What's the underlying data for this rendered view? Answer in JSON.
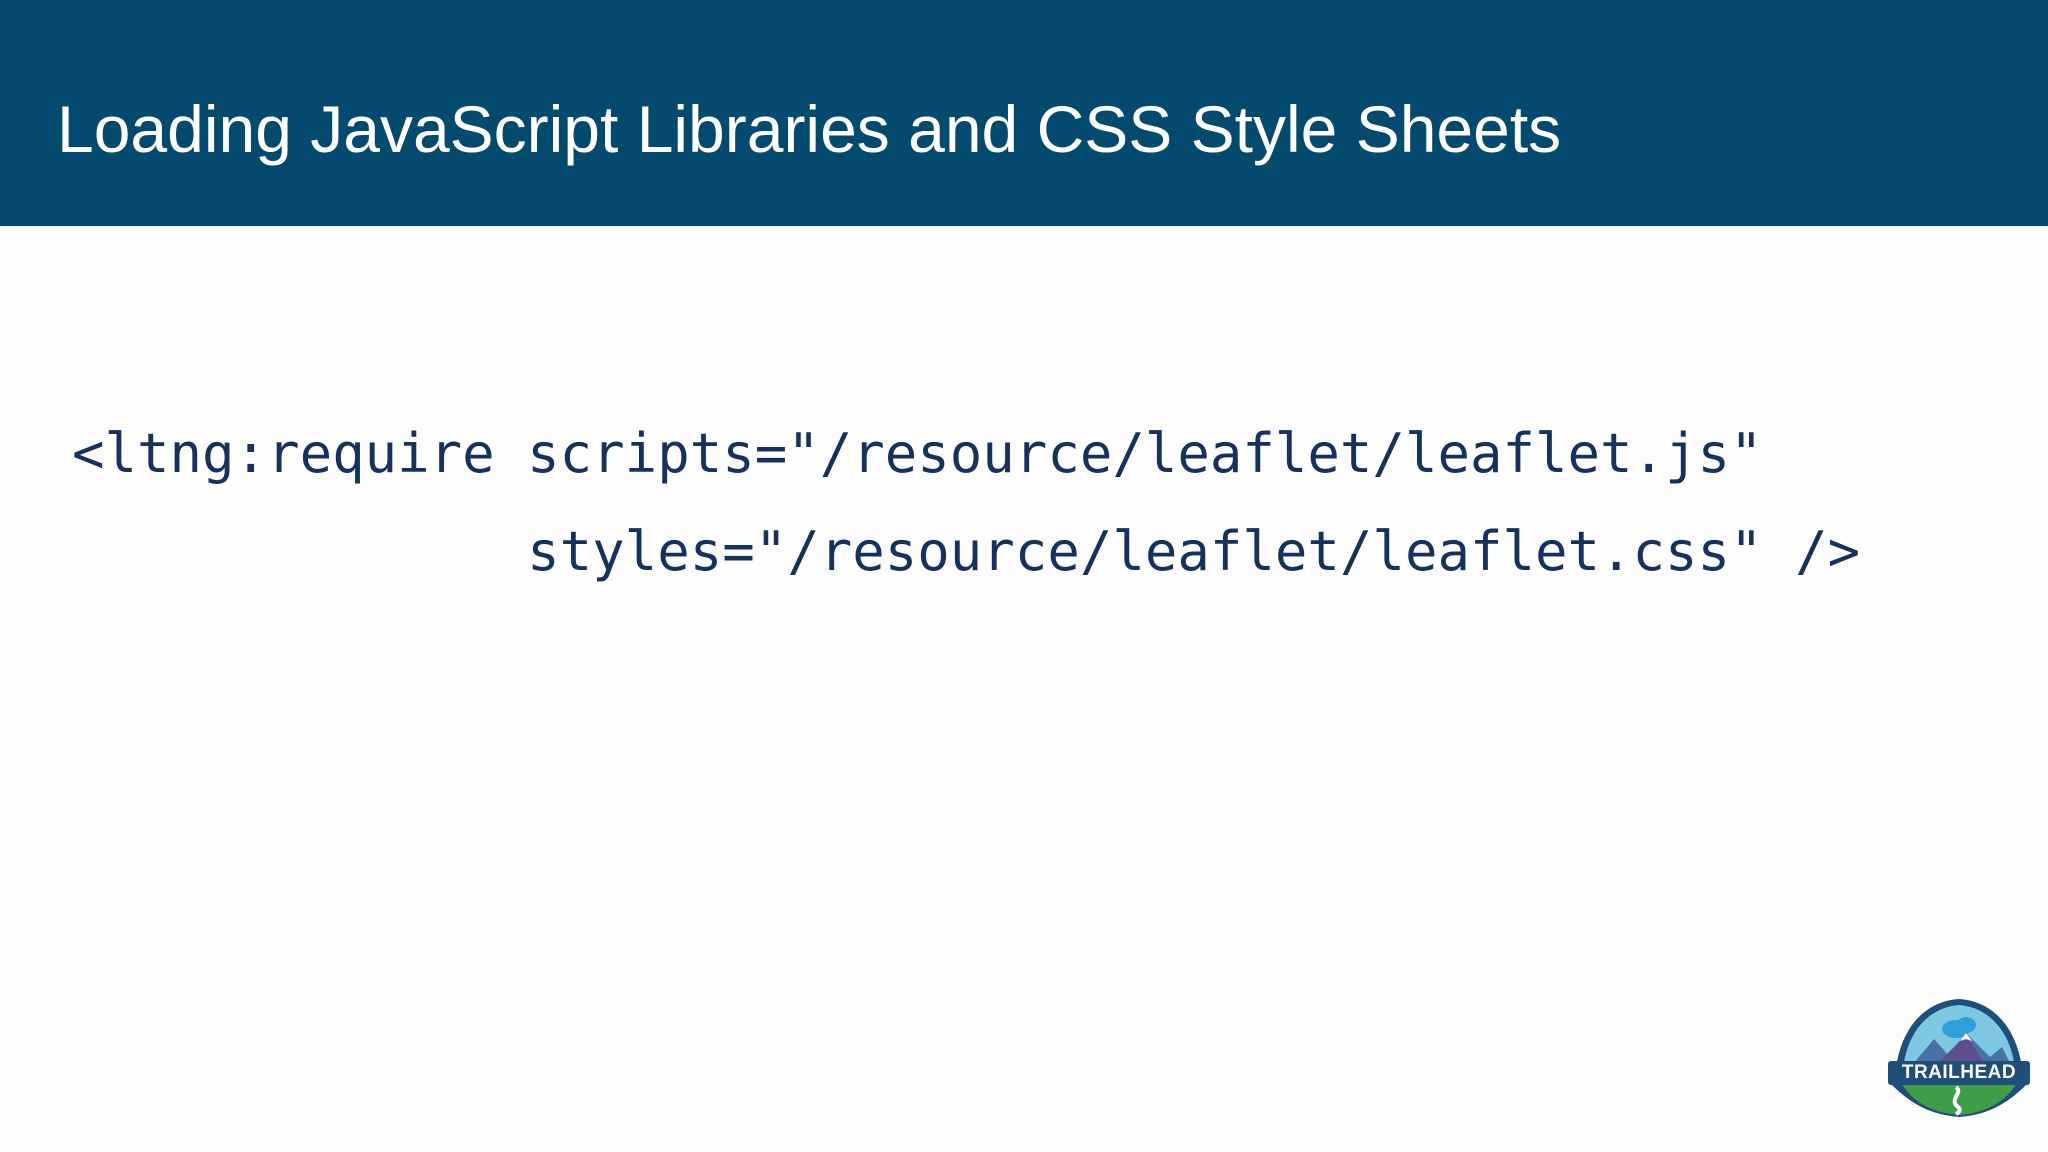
{
  "slide": {
    "title": "Loading JavaScript Libraries and CSS Style Sheets",
    "code_lines": [
      "<ltng:require scripts=\"/resource/leaflet/leaflet.js\"",
      "              styles=\"/resource/leaflet/leaflet.css\" />"
    ]
  },
  "logo": {
    "name": "trailhead-logo-icon",
    "text": "TRAILHEAD"
  },
  "colors": {
    "header_bg": "#034a6e",
    "title_text": "#ffffff",
    "code_text": "#16325c",
    "slide_bg": "#fdfdfe"
  }
}
